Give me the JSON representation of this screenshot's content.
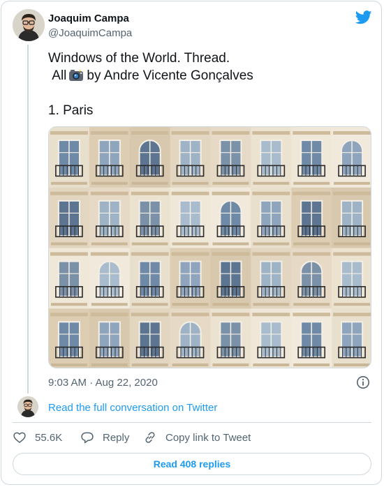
{
  "author": {
    "name": "Joaquim Campa",
    "handle": "@JoaquimCampa"
  },
  "brand_icon": "twitter-bird-icon",
  "tweet": {
    "line1": "Windows of the World. Thread.",
    "line2_prefix": "All",
    "line2_emoji_icon": "camera-with-flash-icon",
    "line2_suffix": "by Andre Vicente Gonçalves",
    "line3": "1. Paris",
    "timestamp": "9:03 AM · Aug 22, 2020"
  },
  "media": {
    "subject": "grid of Parisian windows",
    "grid_columns": 8,
    "grid_rows": 4
  },
  "conversation": {
    "read_full_label": "Read the full conversation on Twitter"
  },
  "actions": {
    "like_count": "55.6K",
    "reply_label": "Reply",
    "copy_link_label": "Copy link to Tweet"
  },
  "footer": {
    "read_replies_label": "Read 408 replies"
  },
  "colors": {
    "accent": "#1d9bf0",
    "text_primary": "#0f1419",
    "text_secondary": "#536471",
    "border": "#cfd9de"
  }
}
